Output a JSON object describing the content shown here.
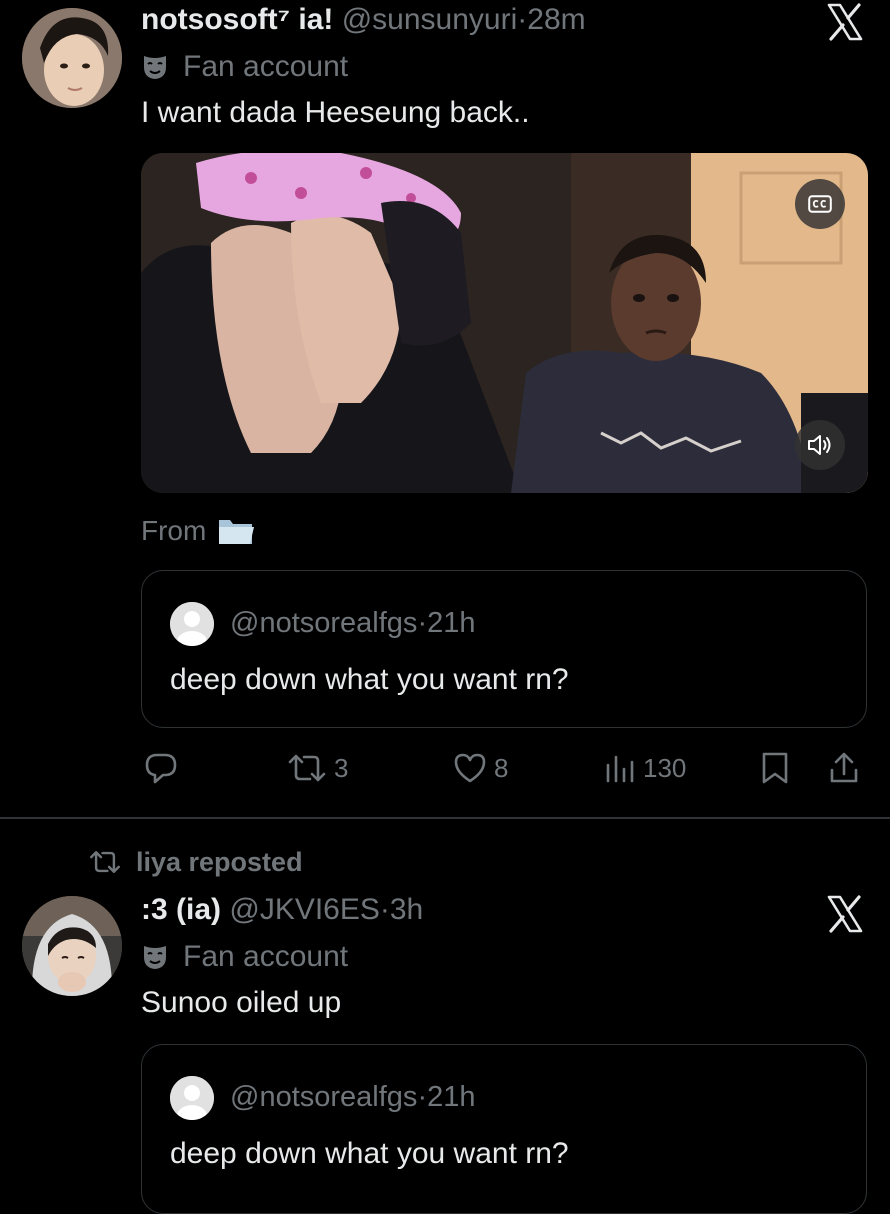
{
  "tweet1": {
    "display_name": "notsosoft⁷ ia!",
    "handle": "@sunsunyuri",
    "separator": "·",
    "time": "28m",
    "label": "Fan account",
    "text": "I want dada Heeseung back..",
    "from_label": "From",
    "quote": {
      "handle": "@notsorealfgs",
      "separator": "·",
      "time": "21h",
      "text": "deep down what you want rn?"
    },
    "metrics": {
      "reposts": "3",
      "likes": "8",
      "views": "130"
    }
  },
  "repost_banner": "liya reposted",
  "tweet2": {
    "display_name": ":3 (ia)",
    "handle": "@JKVI6ES",
    "separator": "·",
    "time": "3h",
    "label": "Fan account",
    "text": "Sunoo oiled up",
    "quote": {
      "handle": "@notsorealfgs",
      "separator": "·",
      "time": "21h",
      "text": "deep down what you want rn?"
    }
  },
  "icons": {
    "close": "x-logo-icon",
    "label": "theater-mask-icon",
    "captions": "closed-captions-icon",
    "volume": "speaker-icon",
    "from": "folder-icon",
    "reply": "reply-icon",
    "repost": "repost-icon",
    "like": "heart-icon",
    "views": "analytics-icon",
    "bookmark": "bookmark-icon",
    "share": "share-icon"
  },
  "colors": {
    "background": "#000000",
    "text_primary": "#e7e9ea",
    "text_secondary": "#71767b",
    "border": "#2f3336"
  }
}
